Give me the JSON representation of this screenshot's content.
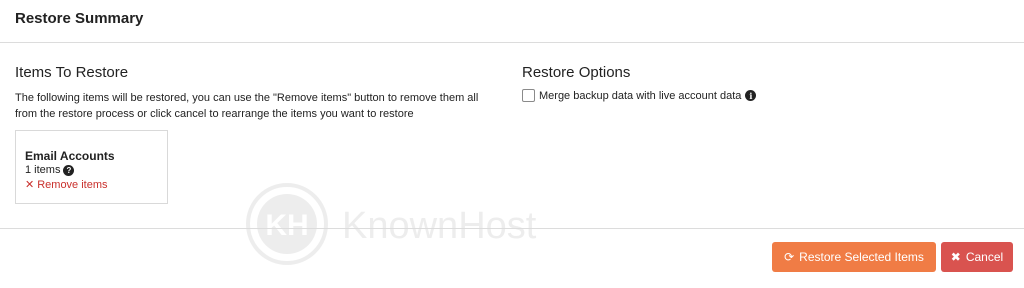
{
  "header": {
    "title": "Restore Summary"
  },
  "items_section": {
    "heading": "Items To Restore",
    "description": "The following items will be restored, you can use the \"Remove items\" button to remove them all from the restore process or click cancel to rearrange the items you want to restore",
    "card": {
      "title": "Email Accounts",
      "count": "1 items",
      "help_icon": "?",
      "remove_label": "Remove items"
    }
  },
  "options_section": {
    "heading": "Restore Options",
    "option_label": "Merge backup data with live account data",
    "option_checked": false,
    "info_icon": "i"
  },
  "watermark": {
    "text": "KnownHost"
  },
  "footer": {
    "restore_button": "Restore Selected Items",
    "cancel_button": "Cancel"
  },
  "colors": {
    "restore_button": "#f07c45",
    "cancel_button": "#d9534f",
    "remove_link": "#c9302c"
  },
  "icons": {
    "restore": "refresh-icon",
    "cancel": "close-icon",
    "remove": "close-icon",
    "help": "question-circle-icon",
    "info": "info-circle-icon"
  }
}
